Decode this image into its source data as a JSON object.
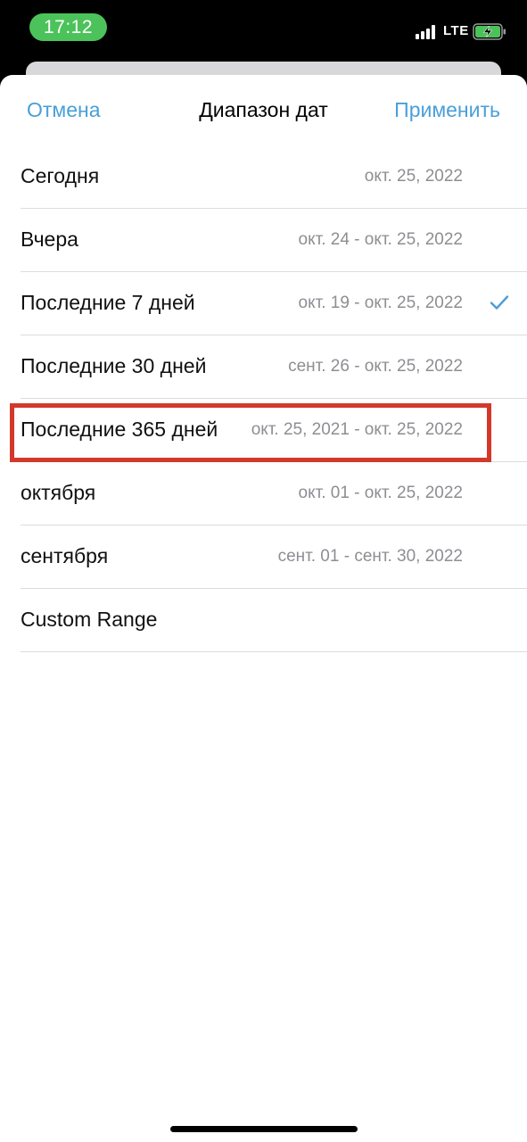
{
  "status_bar": {
    "time": "17:12",
    "network": "LTE",
    "signal_icon": "signal-bars-icon",
    "battery_icon": "battery-charging-icon",
    "accent_color": "#4CC25A"
  },
  "sheet": {
    "cancel_label": "Отмена",
    "title": "Диапазон дат",
    "apply_label": "Применить",
    "accent_color": "#4A9FD8"
  },
  "ranges": [
    {
      "label": "Сегодня",
      "dates": "окт. 25, 2022",
      "selected": false
    },
    {
      "label": "Вчера",
      "dates": "окт. 24 - окт. 25, 2022",
      "selected": false
    },
    {
      "label": "Последние 7 дней",
      "dates": "окт. 19 - окт. 25, 2022",
      "selected": true
    },
    {
      "label": "Последние 30 дней",
      "dates": "сент. 26 - окт. 25, 2022",
      "selected": false
    },
    {
      "label": "Последние 365 дней",
      "dates": "окт. 25, 2021 - окт. 25, 2022",
      "selected": false
    },
    {
      "label": "октября",
      "dates": "окт. 01 - окт. 25, 2022",
      "selected": false
    },
    {
      "label": "сентября",
      "dates": "сент. 01 - сент. 30, 2022",
      "selected": false
    },
    {
      "label": "Custom Range",
      "dates": "",
      "selected": false
    }
  ],
  "annotation": {
    "highlight_color": "#D2392B",
    "highlighted_item": "Последние 365 дней"
  }
}
